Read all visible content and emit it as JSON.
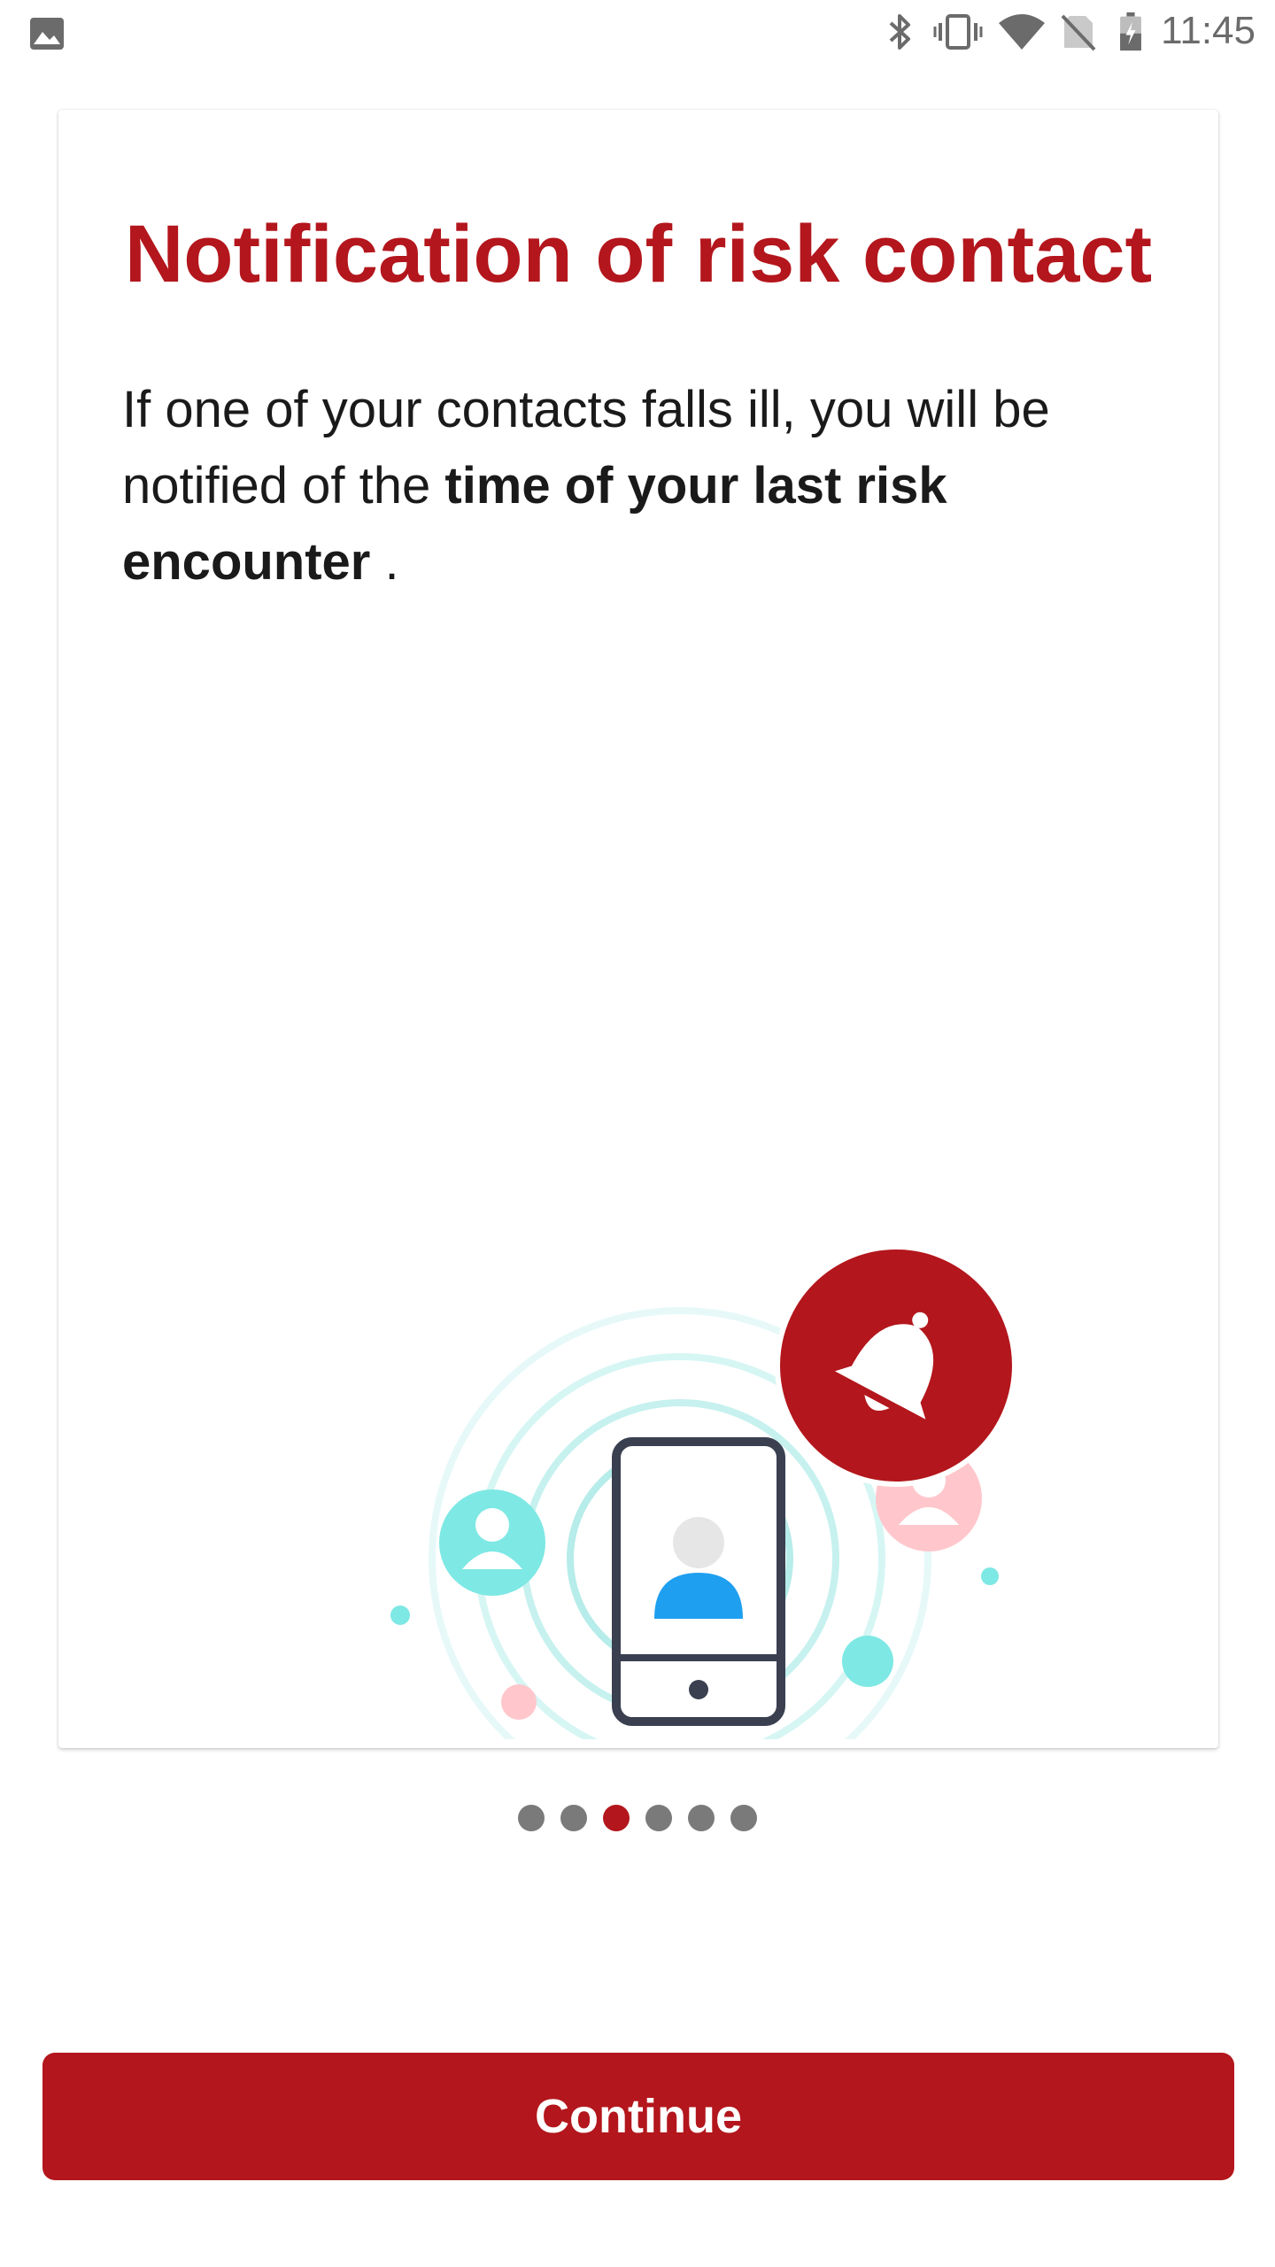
{
  "status_bar": {
    "time": "11:45",
    "left_icons": [
      "gallery-icon"
    ],
    "right_icons": [
      "bluetooth-icon",
      "vibrate-icon",
      "wifi-icon",
      "no-sim-icon",
      "battery-charging-icon"
    ]
  },
  "card": {
    "title": "Notification of risk contact",
    "body_intro": "If one of your contacts falls ill, you will be notified of the ",
    "body_bold": "time of your last risk encounter",
    "body_end": " ."
  },
  "illustration": {
    "icons": [
      "phone-icon",
      "bell-icon",
      "contact-avatar-icon"
    ]
  },
  "pager": {
    "total": 6,
    "current": 3
  },
  "continue_button": {
    "label": "Continue"
  },
  "colors": {
    "accent": "#b3161c",
    "teal": "#7ee8e4",
    "pink": "#ffc7cc",
    "phone_user": "#1e9ff0",
    "dot_inactive": "#7a7a7a"
  }
}
